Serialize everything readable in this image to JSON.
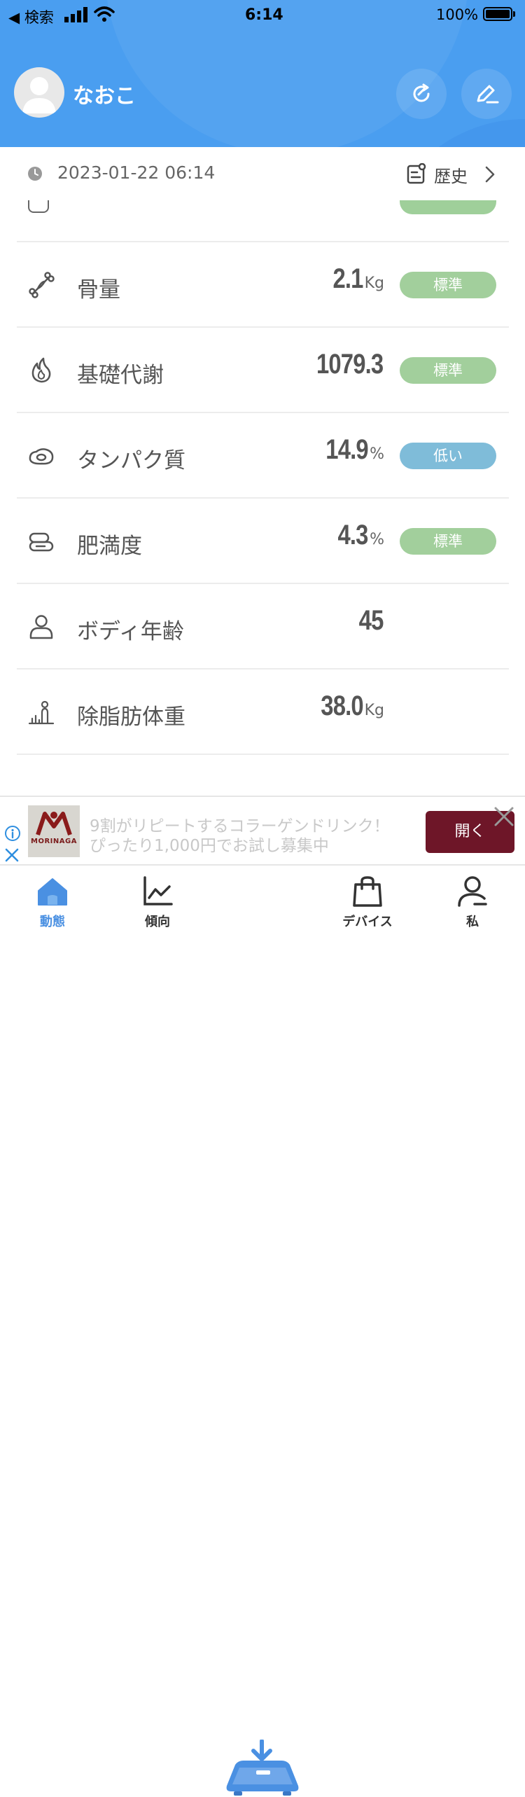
{
  "status_bar": {
    "back_label": "◀ 検索",
    "time": "6:14",
    "battery": "100%"
  },
  "header": {
    "username": "なおこ"
  },
  "date_bar": {
    "datetime": "2023-01-22 06:14",
    "history_label": "歴史"
  },
  "metrics": [
    {
      "icon": "bone-icon",
      "label": "骨量",
      "value": "2.1",
      "unit": "Kg",
      "status": "標準",
      "status_color": "#a2cf9c"
    },
    {
      "icon": "flame-icon",
      "label": "基礎代謝",
      "value": "1079.3",
      "unit": "",
      "status": "標準",
      "status_color": "#a2cf9c"
    },
    {
      "icon": "egg-icon",
      "label": "タンパク質",
      "value": "14.9",
      "unit": "%",
      "status": "低い",
      "status_color": "#7fbcd9"
    },
    {
      "icon": "fat-icon",
      "label": "肥満度",
      "value": "4.3",
      "unit": "%",
      "status": "標準",
      "status_color": "#a2cf9c"
    },
    {
      "icon": "person-icon",
      "label": "ボディ年齢",
      "value": "45",
      "unit": "",
      "status": "",
      "status_color": ""
    },
    {
      "icon": "body-scale-icon",
      "label": "除脂肪体重",
      "value": "38.0",
      "unit": "Kg",
      "status": "",
      "status_color": ""
    }
  ],
  "ad": {
    "brand": "MORINAGA",
    "line1": "9割がリピートするコラーゲンドリンク！",
    "line2": "ぴったり1,000円でお試し募集中",
    "open_label": "開く"
  },
  "tabs": [
    {
      "label": "動態",
      "icon": "home-icon",
      "active": true
    },
    {
      "label": "傾向",
      "icon": "chart-icon",
      "active": false
    },
    {
      "label": "",
      "icon": "scale-icon",
      "active": false
    },
    {
      "label": "デバイス",
      "icon": "bag-icon",
      "active": false
    },
    {
      "label": "私",
      "icon": "user-icon",
      "active": false
    }
  ],
  "colors": {
    "header_blue": "#4a9ef0",
    "tab_active": "#4a90e2",
    "ad_button": "#6e1628"
  }
}
